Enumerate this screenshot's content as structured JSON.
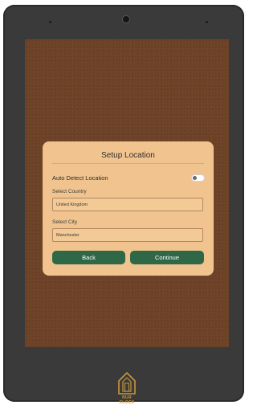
{
  "dialog": {
    "title": "Setup Location",
    "auto_detect_label": "Auto Detect Location",
    "auto_detect_enabled": false,
    "country_label": "Select Country",
    "country_value": "United Kingdom",
    "city_label": "Select City",
    "city_value": "Manchester",
    "back_label": "Back",
    "continue_label": "Continue"
  },
  "brand": {
    "logo_text": "NUR CLOCK",
    "accent": "#c9963b"
  },
  "colors": {
    "screen_bg": "#6e4328",
    "dialog_bg": "#f1c48f",
    "button_bg": "#2f6847"
  }
}
